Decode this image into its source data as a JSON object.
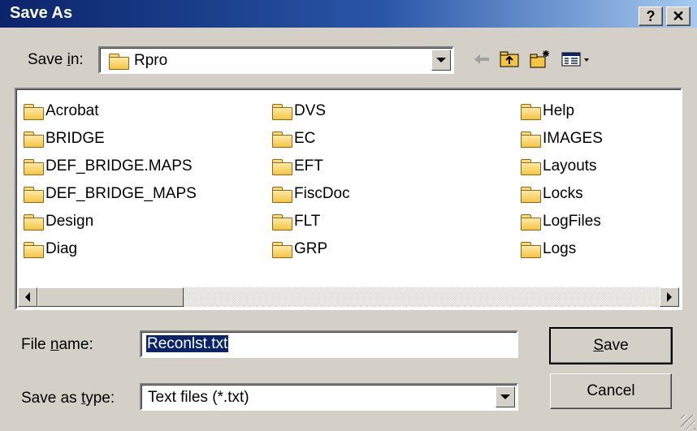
{
  "window": {
    "title": "Save As"
  },
  "caption_buttons": {
    "help": "?",
    "close": "✕"
  },
  "save_in": {
    "label_pre": "Save ",
    "label_accel": "i",
    "label_post": "n:",
    "value": "Rpro"
  },
  "toolbar": {
    "back_icon": "back-arrow-icon",
    "up_icon": "up-folder-icon",
    "new_folder_icon": "new-folder-icon",
    "view_icon": "view-menu-icon"
  },
  "files": {
    "col1": [
      "Acrobat",
      "BRIDGE",
      "DEF_BRIDGE.MAPS",
      "DEF_BRIDGE_MAPS",
      "Design",
      "Diag"
    ],
    "col2": [
      "DVS",
      "EC",
      "EFT",
      "FiscDoc",
      "FLT",
      "GRP"
    ],
    "col3": [
      "Help",
      "IMAGES",
      "Layouts",
      "Locks",
      "LogFiles",
      "Logs"
    ]
  },
  "file_name": {
    "label_pre": "File ",
    "label_accel": "n",
    "label_post": "ame:",
    "value": "Reconlst.txt"
  },
  "save_as_type": {
    "label_pre": "Save as ",
    "label_accel": "t",
    "label_post": "ype:",
    "value": "Text files (*.txt)"
  },
  "buttons": {
    "save_accel": "S",
    "save_rest": "ave",
    "cancel": "Cancel"
  }
}
